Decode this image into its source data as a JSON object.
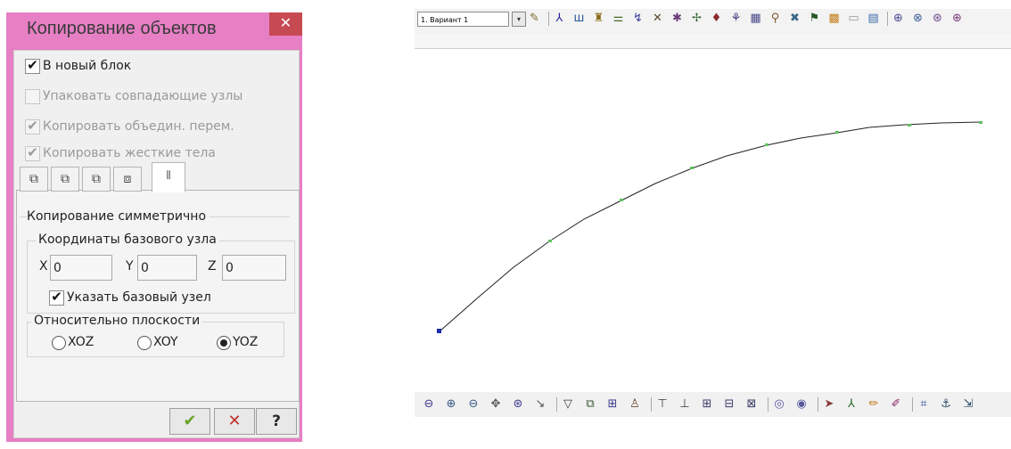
{
  "dialog": {
    "title": "Копирование объектов",
    "close_glyph": "✕",
    "check_new_block": "В новый блок",
    "check_pack_nodes": "Упаковать совпадающие узлы",
    "check_copy_united": "Копировать объедин. перем.",
    "check_copy_rigid": "Копировать жесткие тела",
    "check_mark": "✔",
    "tabs": [
      "tab-copy-1",
      "tab-copy-2",
      "tab-copy-3",
      "tab-copy-4",
      "tab-copy-symmetric"
    ],
    "group_symmetric": "Копирование симметрично",
    "group_base_node": "Координаты базового узла",
    "x_label": "X",
    "y_label": "Y",
    "z_label": "Z",
    "x_value": "0",
    "y_value": "0",
    "z_value": "0",
    "check_specify_node": "Указать базовый узел",
    "group_plane": "Относительно плоскости",
    "radio_xoz": "XOZ",
    "radio_xoy": "XOY",
    "radio_yoz": "YOZ",
    "selected_plane": "YOZ",
    "ok_glyph": "✔",
    "cancel_glyph": "✕",
    "help_glyph": "?"
  },
  "app": {
    "variant": "1. Вариант 1",
    "variant_arrow": "▾",
    "top_icons": [
      {
        "name": "brush-icon",
        "glyph": "✎",
        "color": "#7a6a2a"
      },
      {
        "name": "node-icon",
        "glyph": "⅄",
        "color": "#2b2b9a"
      },
      {
        "name": "support-icon",
        "glyph": "ш",
        "color": "#2b5a9a"
      },
      {
        "name": "hinge-icon",
        "glyph": "♜",
        "color": "#8a6a1a"
      },
      {
        "name": "rigid-icon",
        "glyph": "⚌",
        "color": "#4a6a2a"
      },
      {
        "name": "load-icon",
        "glyph": "↯",
        "color": "#3a3a9a"
      },
      {
        "name": "force-icon",
        "glyph": "✕",
        "color": "#5a4a2a"
      },
      {
        "name": "moment-icon",
        "glyph": "✱",
        "color": "#6a3a7a"
      },
      {
        "name": "axis-icon",
        "glyph": "✢",
        "color": "#3a6a3a"
      },
      {
        "name": "pin-icon",
        "glyph": "♦",
        "color": "#8a2a2a"
      },
      {
        "name": "spring-icon",
        "glyph": "⚘",
        "color": "#3a3a7a"
      },
      {
        "name": "plate-icon",
        "glyph": "▦",
        "color": "#4a4a8a"
      },
      {
        "name": "link-icon",
        "glyph": "⚲",
        "color": "#7a5a2a"
      },
      {
        "name": "cross-icon",
        "glyph": "✖",
        "color": "#3a6a8a"
      },
      {
        "name": "flag-icon",
        "glyph": "⚑",
        "color": "#2a5a2a"
      },
      {
        "name": "color-icon",
        "glyph": "▩",
        "color": "#c4801a"
      },
      {
        "name": "ruler-icon",
        "glyph": "▭",
        "color": "#999999"
      },
      {
        "name": "grid-icon",
        "glyph": "▤",
        "color": "#3a6aaa"
      },
      {
        "name": "view-1-icon",
        "glyph": "⊕",
        "color": "#4a4a9a"
      },
      {
        "name": "view-2-icon",
        "glyph": "⊗",
        "color": "#3a5a9a"
      },
      {
        "name": "view-3-icon",
        "glyph": "⊛",
        "color": "#6a4a8a"
      },
      {
        "name": "view-4-icon",
        "glyph": "⊕",
        "color": "#7a3a7a"
      }
    ],
    "bottom_icons": [
      {
        "name": "zoom-window-icon",
        "glyph": "⊖",
        "color": "#3a3a8a"
      },
      {
        "name": "zoom-in-icon",
        "glyph": "⊕",
        "color": "#3a5a8a"
      },
      {
        "name": "zoom-out-icon",
        "glyph": "⊖",
        "color": "#3a5a8a"
      },
      {
        "name": "pan-icon",
        "glyph": "✥",
        "color": "#5a5a5a"
      },
      {
        "name": "zoom-all-icon",
        "glyph": "⊛",
        "color": "#3a3a8a"
      },
      {
        "name": "select-icon",
        "glyph": "↘",
        "color": "#555555"
      },
      {
        "name": "filter-icon",
        "glyph": "▽",
        "color": "#3a3a3a"
      },
      {
        "name": "section-icon",
        "glyph": "⧉",
        "color": "#3a5a3a"
      },
      {
        "name": "fragment-icon",
        "glyph": "⊞",
        "color": "#3a3a8a"
      },
      {
        "name": "frame-icon",
        "glyph": "♙",
        "color": "#6a4a2a"
      },
      {
        "name": "mesh-1-icon",
        "glyph": "⊤",
        "color": "#3a3a3a"
      },
      {
        "name": "mesh-2-icon",
        "glyph": "⊥",
        "color": "#3a3a3a"
      },
      {
        "name": "mesh-3-icon",
        "glyph": "⊞",
        "color": "#3a3a6a"
      },
      {
        "name": "mesh-4-icon",
        "glyph": "⊟",
        "color": "#3a3a6a"
      },
      {
        "name": "mesh-5-icon",
        "glyph": "⊠",
        "color": "#3a3a6a"
      },
      {
        "name": "magnify-icon",
        "glyph": "◎",
        "color": "#5a5aa0"
      },
      {
        "name": "magnify-2-icon",
        "glyph": "◉",
        "color": "#5a5aa0"
      },
      {
        "name": "pointer-icon",
        "glyph": "➤",
        "color": "#8a3a3a"
      },
      {
        "name": "axes-icon",
        "glyph": "⅄",
        "color": "#2a6a2a"
      },
      {
        "name": "pencil-icon",
        "glyph": "✏",
        "color": "#c47a1a"
      },
      {
        "name": "marker-icon",
        "glyph": "✐",
        "color": "#8a2a6a"
      },
      {
        "name": "coords-icon",
        "glyph": "⌗",
        "color": "#2a4a9a"
      },
      {
        "name": "anchor-icon",
        "glyph": "⚓",
        "color": "#2a4a6a"
      },
      {
        "name": "scale-icon",
        "glyph": "⇲",
        "color": "#2a4a6a"
      }
    ]
  },
  "colors": {
    "dialog_frame": "#e67fc4",
    "close_button": "#c74a52",
    "node_green": "#5fc25f",
    "start_node": "#1a2aa8"
  }
}
